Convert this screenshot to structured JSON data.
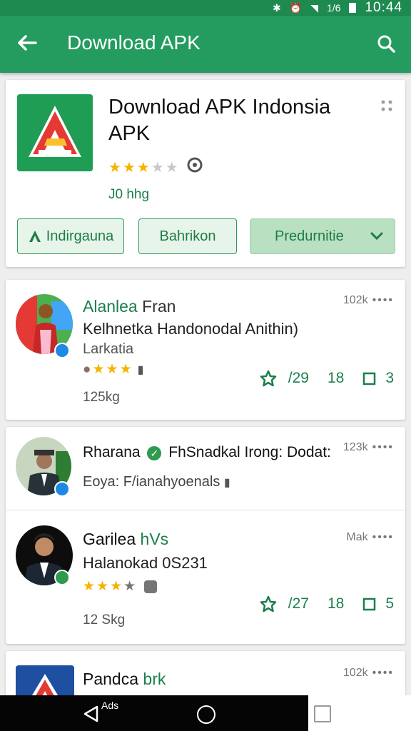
{
  "status_bar": {
    "time": "10:44",
    "signal_text": "1/6"
  },
  "app_bar": {
    "title": "Download APK"
  },
  "hero": {
    "title": "Download APK Indonsia APK",
    "rating": 3,
    "size": "J0 hhg",
    "buttons": {
      "primary": "Indirgauna",
      "secondary": "Bahrikon",
      "dropdown": "Predurnitie"
    }
  },
  "items": [
    {
      "name": "Alanlea",
      "name_suffix": "Fran",
      "subtitle": "Kelhnetka Handonodal Anithin)",
      "line3": "Larkatia",
      "meta": "102k",
      "rating": 3,
      "likes": "/29",
      "comments": "18",
      "shares": "3",
      "size": "125kg"
    },
    {
      "name": "Rharana",
      "subtitle_tail": "FhSnadkal Irong: Dodat:",
      "line2": "Eoya: F/ianahyoenals",
      "meta": "123k"
    },
    {
      "name": "Garilea",
      "name_suffix": "hVs",
      "subtitle": "Halanokad 0S231",
      "meta": "Mak",
      "rating": 3,
      "likes": "/27",
      "comments": "18",
      "shares": "5",
      "size": "12 Skg"
    },
    {
      "name": "Pandca",
      "name_suffix": "brk",
      "meta": "102k"
    }
  ],
  "nav_bar": {
    "back_label": "Ads"
  },
  "colors": {
    "primary": "#249b5f",
    "accent": "#1b7f4c",
    "star": "#f4b400"
  }
}
